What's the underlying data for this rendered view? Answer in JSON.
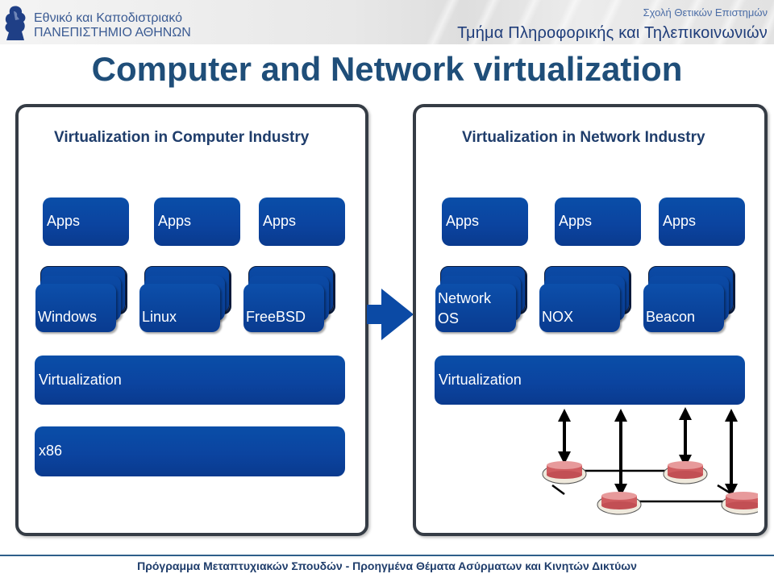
{
  "header": {
    "university_line1": "Εθνικό και Καποδιστριακό",
    "university_line2": "ΠΑΝΕΠΙΣΤΗΜΙΟ ΑΘΗΝΩΝ",
    "school": "Σχολή Θετικών Επιστημών",
    "department": "Τμήμα Πληροφορικής και Τηλεπικοινωνιών",
    "logo_icon": "university-logo-icon"
  },
  "title": "Computer and Network virtualization",
  "left_panel": {
    "heading": "Virtualization in Computer Industry",
    "apps": [
      "Apps",
      "Apps",
      "Apps"
    ],
    "os": [
      "Windows",
      "Linux",
      "FreeBSD"
    ],
    "virtualization": "Virtualization",
    "hardware": "x86"
  },
  "arrow_icon": "right-arrow-icon",
  "right_panel": {
    "heading": "Virtualization in Network Industry",
    "apps": [
      "Apps",
      "Apps",
      "Apps"
    ],
    "os": [
      "Network OS",
      "NOX",
      "Beacon"
    ],
    "os_lines": [
      [
        "Network",
        "OS"
      ],
      [
        "NOX"
      ],
      [
        "Beacon"
      ]
    ],
    "virtualization": "Virtualization",
    "network_icons": "router-network-icon"
  },
  "colors": {
    "title": "#1f4e79",
    "box_blue": "#0b44a0",
    "panel_border": "#353c45",
    "router_red": "#d9676a"
  },
  "footer": "Πρόγραμμα Μεταπτυχιακών Σπουδών - Προηγμένα Θέματα Ασύρματων και Κινητών Δικτύων"
}
